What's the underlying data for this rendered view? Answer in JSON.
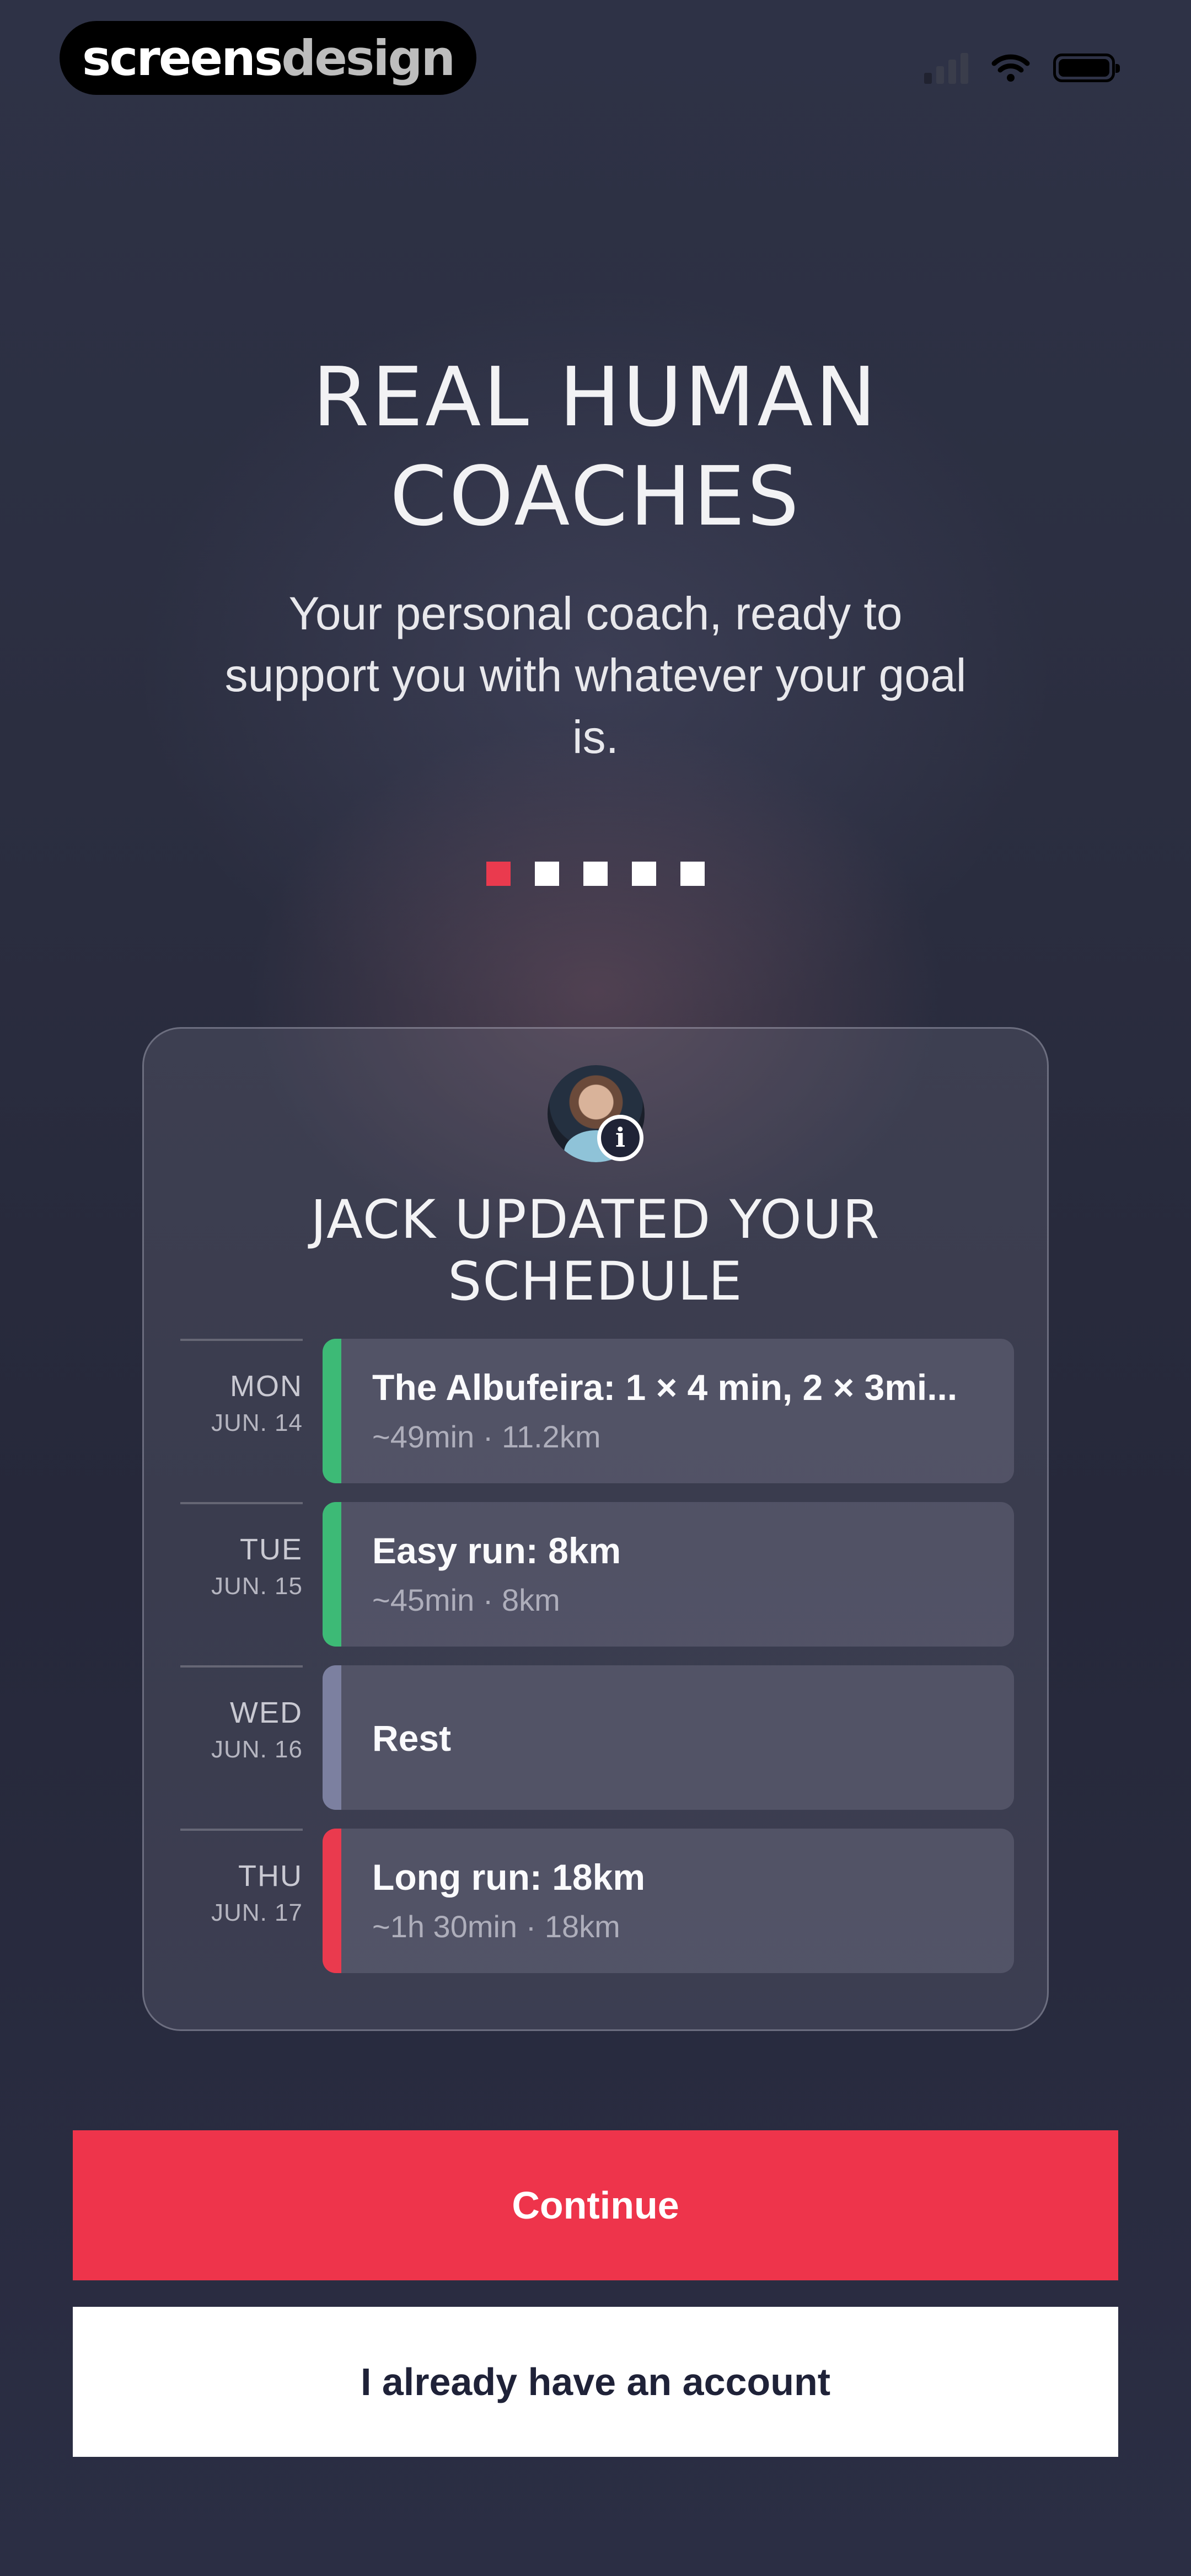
{
  "status_bar": {
    "brand_part1": "screens",
    "brand_part2": "design",
    "icons": [
      "cellular-signal-icon",
      "wifi-icon",
      "battery-icon"
    ]
  },
  "hero": {
    "title_line1": "REAL HUMAN",
    "title_line2": "COACHES",
    "subtitle": "Your personal coach, ready to support you with whatever your goal is."
  },
  "pager": {
    "total": 5,
    "active_index": 0,
    "active_color": "#ea3a4e"
  },
  "card": {
    "avatar_icon": "coach-avatar",
    "badge_icon": "info-icon",
    "title_line1": "JACK UPDATED YOUR",
    "title_line2": "SCHEDULE",
    "rows": [
      {
        "day": "MON",
        "date": "JUN. 14",
        "title": "The Albufeira: 1 × 4 min, 2 × 3mi...",
        "meta": "~49min · 11.2km",
        "color": "#3dba76"
      },
      {
        "day": "TUE",
        "date": "JUN. 15",
        "title": "Easy run: 8km",
        "meta": "~45min · 8km",
        "color": "#3dba76"
      },
      {
        "day": "WED",
        "date": "JUN. 16",
        "title": "Rest",
        "meta": "",
        "color": "#7c80a0"
      },
      {
        "day": "THU",
        "date": "JUN. 17",
        "title": "Long run: 18km",
        "meta": "~1h 30min · 18km",
        "color": "#ea3a4e"
      }
    ]
  },
  "actions": {
    "continue_label": "Continue",
    "continue_color": "#ee344b",
    "account_label": "I already have an account"
  }
}
